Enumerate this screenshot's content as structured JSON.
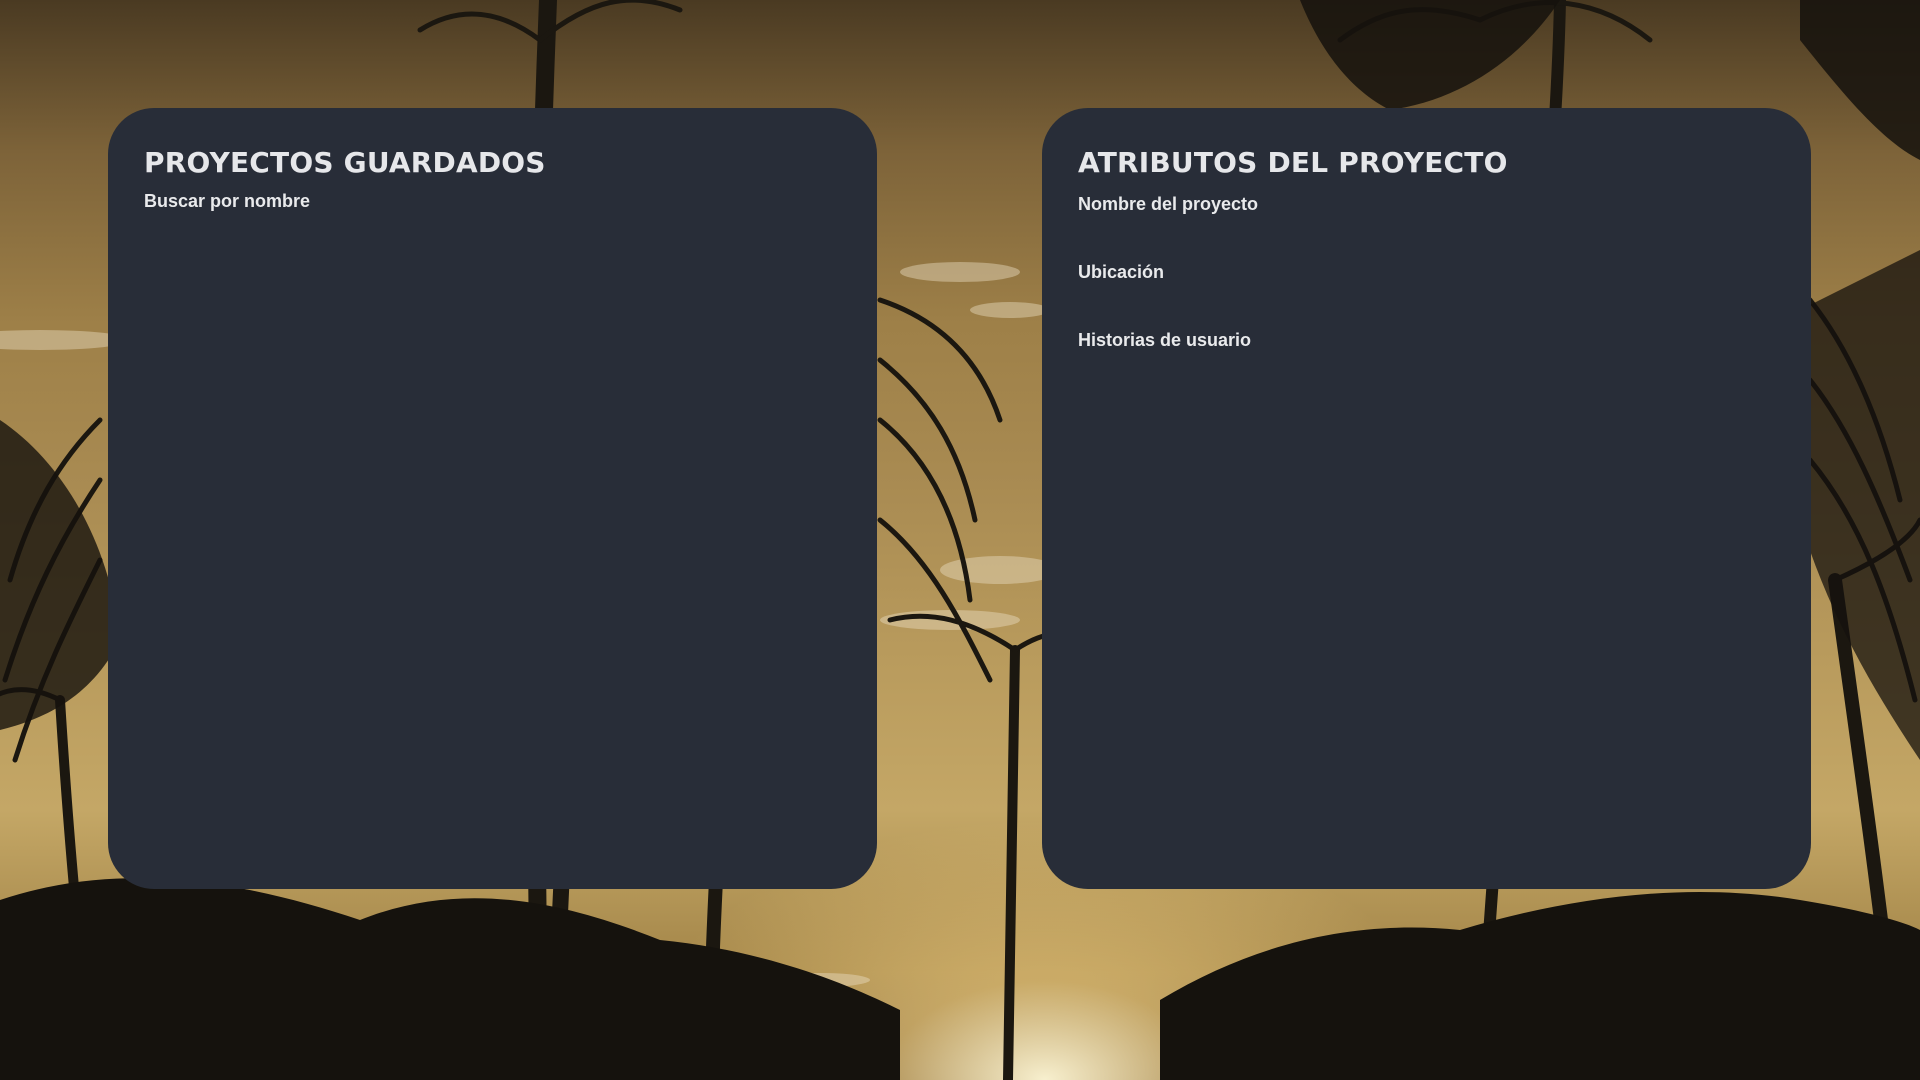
{
  "saved_projects": {
    "title": "PROYECTOS GUARDADOS",
    "search_label": "Buscar por nombre"
  },
  "project_attributes": {
    "title": "ATRIBUTOS DEL PROYECTO",
    "name_label": "Nombre del proyecto",
    "location_label": "Ubicación",
    "user_stories_label": "Historias de usuario"
  },
  "colors": {
    "panel_background": "#282d38",
    "text": "#e6e7ea"
  },
  "background_image": "palm-trees-sunset-photo"
}
